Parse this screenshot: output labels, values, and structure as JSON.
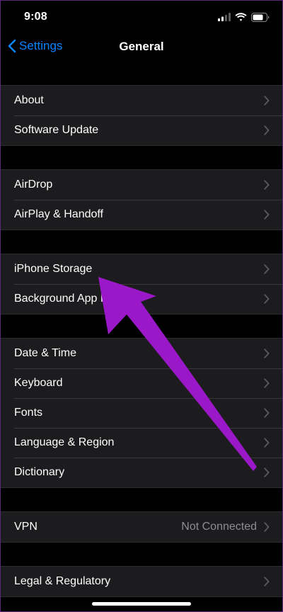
{
  "status_bar": {
    "time": "9:08",
    "signal_icon": "cellular-signal-icon",
    "wifi_icon": "wifi-icon",
    "battery_icon": "battery-icon"
  },
  "nav": {
    "back_label": "Settings",
    "title": "General"
  },
  "groups": [
    {
      "rows": [
        {
          "label": "About"
        },
        {
          "label": "Software Update"
        }
      ]
    },
    {
      "rows": [
        {
          "label": "AirDrop"
        },
        {
          "label": "AirPlay & Handoff"
        }
      ]
    },
    {
      "rows": [
        {
          "label": "iPhone Storage"
        },
        {
          "label": "Background App Refresh"
        }
      ]
    },
    {
      "rows": [
        {
          "label": "Date & Time"
        },
        {
          "label": "Keyboard"
        },
        {
          "label": "Fonts"
        },
        {
          "label": "Language & Region"
        },
        {
          "label": "Dictionary"
        }
      ]
    },
    {
      "rows": [
        {
          "label": "VPN",
          "value": "Not Connected"
        }
      ]
    },
    {
      "rows": [
        {
          "label": "Legal & Regulatory"
        }
      ]
    }
  ],
  "colors": {
    "accent": "#0a84ff",
    "background": "#000000",
    "cell": "#1c1c1e",
    "annotation": "#9b18c8"
  }
}
